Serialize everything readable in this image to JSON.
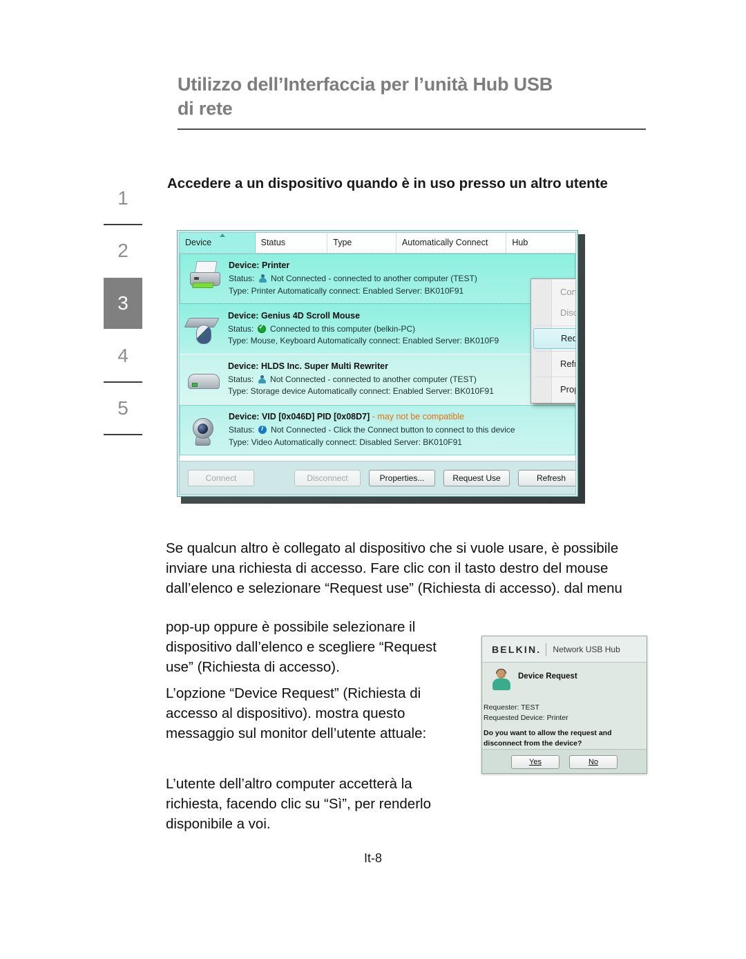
{
  "page": {
    "title_line1": "Utilizzo dell’Interfaccia per l’unità Hub USB",
    "title_line2": "di rete",
    "page_number": "It-8"
  },
  "rail": {
    "items": [
      {
        "label": "1",
        "active": false
      },
      {
        "label": "2",
        "active": false
      },
      {
        "label": "3",
        "active": true
      },
      {
        "label": "4",
        "active": false
      },
      {
        "label": "5",
        "active": false
      }
    ]
  },
  "section": {
    "heading": "Accedere a un dispositivo quando è in uso presso un altro utente"
  },
  "app_screenshot": {
    "table_headers": [
      {
        "label": "Device",
        "sorted": true,
        "sort_arrow": "ascending"
      },
      {
        "label": "Status",
        "sorted": false
      },
      {
        "label": "Type",
        "sorted": false
      },
      {
        "label": "Automatically Connect",
        "sorted": false
      },
      {
        "label": "Hub",
        "sorted": false
      }
    ],
    "devices": [
      {
        "title": "Device: Printer",
        "warning": "",
        "status_icon": "user-icon",
        "status_label": "Status:",
        "status_text": "Not Connected - connected to another computer (TEST)",
        "detail": "Type: Printer   Automatically connect: Enabled   Server: BK010F91",
        "icon": "printer-icon"
      },
      {
        "title": "Device: Genius 4D Scroll Mouse",
        "warning": "",
        "status_icon": "check-icon",
        "status_label": "Status:",
        "status_text": "Connected to this computer (belkin-PC)",
        "detail": "Type: Mouse, Keyboard   Automatically connect: Enabled   Server: BK010F9",
        "icon": "mouse-keyboard-icon"
      },
      {
        "title": "Device: HLDS Inc. Super Multi Rewriter",
        "warning": "",
        "status_icon": "user-icon",
        "status_label": "Status:",
        "status_text": "Not Connected - connected to another computer (TEST)",
        "detail": "Type: Storage device   Automatically connect: Enabled   Server: BK010F91",
        "icon": "storage-icon"
      },
      {
        "title": "Device: VID [0x046D] PID [0x08D7]",
        "warning": "- may not be compatible",
        "status_icon": "info-icon",
        "status_label": "Status:",
        "status_text": "Not Connected - Click the Connect button to connect to this device",
        "detail": "Type: Video   Automatically connect: Disabled   Server: BK010F91",
        "icon": "webcam-icon"
      }
    ],
    "buttons": [
      {
        "label": "Connect",
        "disabled": true
      },
      {
        "label": "Disconnect",
        "disabled": true
      },
      {
        "label": "Properties...",
        "disabled": false
      },
      {
        "label": "Request Use",
        "disabled": false
      },
      {
        "label": "Refresh",
        "disabled": false
      }
    ],
    "context_menu": [
      {
        "label": "Connect",
        "state": "disabled"
      },
      {
        "label": "Disconnect",
        "state": "disabled"
      },
      {
        "label": "Request Use",
        "state": "highlighted"
      },
      {
        "label": "Refresh",
        "state": "normal"
      },
      {
        "label": "Properties...",
        "state": "normal"
      }
    ]
  },
  "body": {
    "paragraph1": "Se qualcun altro è collegato al dispositivo che si vuole usare, è possibile inviare una richiesta di accesso. Fare clic con il tasto destro del mouse dall’elenco e selezionare “Request use” (Richiesta di accesso). dal menu",
    "paragraph2": "pop-up oppure è possibile selezionare il dispositivo dall’elenco e scegliere “Request use” (Richiesta di accesso).",
    "paragraph3": "L’opzione “Device Request” (Richiesta di accesso al dispositivo). mostra questo messaggio sul monitor dell’utente attuale:",
    "paragraph4": "L’utente dell’altro computer accetterà la richiesta, facendo clic su “Sì”, per renderlo disponibile a voi."
  },
  "belkin_dialog": {
    "brand": "BELKIN.",
    "product": "Network USB Hub",
    "title": "Device Request",
    "requester": "Requester: TEST",
    "requested_device": "Requested Device: Printer",
    "question": "Do you want to allow the request and disconnect from the device?",
    "yes_label": "Yes",
    "no_label": "No"
  },
  "colors": {
    "heading_gray": "#7d7d7d",
    "rail_active_bg": "#808080",
    "teal_row": "#8ef0e0",
    "warning_orange": "#e06f12",
    "status_ok_green": "#18a432",
    "status_info_blue": "#1878c8"
  }
}
